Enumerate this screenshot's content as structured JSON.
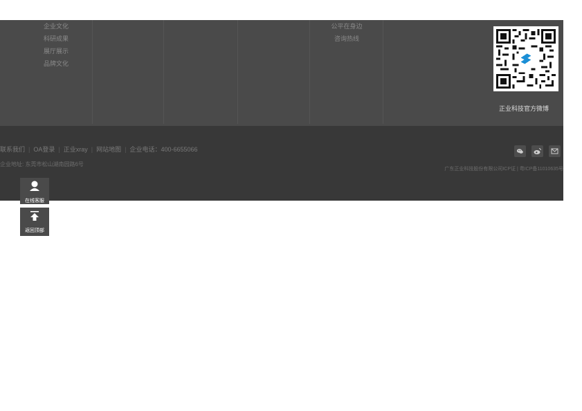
{
  "footer_nav": {
    "col1": [
      "企业文化",
      "科研成果",
      "展厅展示",
      "品牌文化"
    ],
    "col5": [
      "公平在身边",
      "咨询热线"
    ]
  },
  "qr": {
    "caption": "正业科技官方微博",
    "accent": "#1b8fd6"
  },
  "bottom": {
    "links": [
      "联系我们",
      "OA登录",
      "正业xray",
      "网站地图",
      "企业电话：400-6655066"
    ],
    "address": "企业地址: 东莞市松山湖南园路6号",
    "copyright": "广东正业科技股份有限公司ICP证 | 粤ICP备11010635号",
    "social_icons": [
      "wechat-icon",
      "weibo-icon",
      "mail-icon"
    ]
  },
  "float": {
    "service_label": "在线客服",
    "top_label": "返回顶部"
  },
  "colors": {
    "footer_top_bg": "#4a4a4a",
    "footer_bottom_bg": "#383838",
    "link_text": "#8a8a8a"
  }
}
